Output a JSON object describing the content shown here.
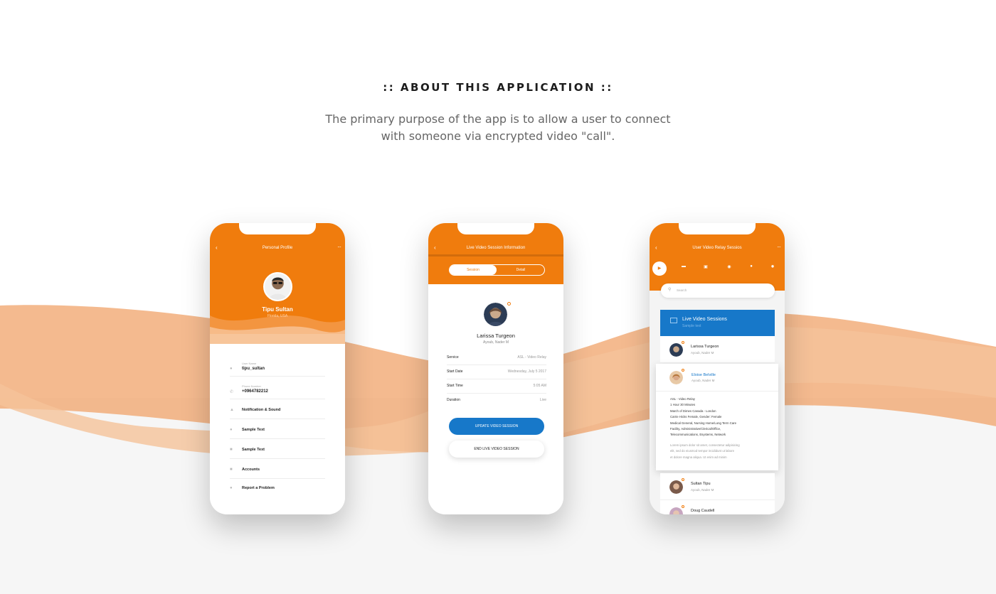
{
  "page": {
    "heading": ":: ABOUT THIS APPLICATION ::",
    "description_line1": "The primary purpose of the app is to allow a user to connect",
    "description_line2": "with someone via encrypted video \"call\".",
    "accent_color": "#f07c0d",
    "blue_color": "#1778c9"
  },
  "phone1": {
    "title": "Personal Profile",
    "back_icon": "chevron-left-icon",
    "menu_icon": "more-icon",
    "profile": {
      "name": "Tipu Sultan",
      "location": "Florida, USA"
    },
    "fields": [
      {
        "label": "User Name",
        "value": "tipu_sultan",
        "icon": "user-icon"
      },
      {
        "label": "Phone Number",
        "value": "+0964782212",
        "icon": "phone-icon"
      }
    ],
    "menu": [
      {
        "label": "Notification & Sound",
        "icon": "bell-icon"
      },
      {
        "label": "Sample Text",
        "icon": "person-icon"
      },
      {
        "label": "Sample Text",
        "icon": "card-icon"
      },
      {
        "label": "Accounts",
        "icon": "lock-icon"
      },
      {
        "label": "Report a Problem",
        "icon": "info-icon"
      }
    ]
  },
  "phone2": {
    "title": "Live Video Session Information",
    "tabs": [
      "Session",
      "Detail"
    ],
    "contact": {
      "name": "Larissa Turgeon",
      "subtitle": "Ayoub, Nader M"
    },
    "details": [
      {
        "key": "Service",
        "value": "ASL - Video Relay"
      },
      {
        "key": "Start Date",
        "value": "Wednesday, July 5 2017"
      },
      {
        "key": "Start Time",
        "value": "5:05 AM"
      },
      {
        "key": "Duration",
        "value": "Live"
      }
    ],
    "primary_button": "UPDATE VIDEO SESSION",
    "secondary_button": "END LIVE VIDEO SESSION"
  },
  "phone3": {
    "title": "User Video Relay Sessios",
    "tab_icons": [
      "play-icon",
      "screen-icon",
      "camera-icon",
      "eye-icon",
      "user-icon",
      "gear-icon"
    ],
    "search_placeholder": "Search",
    "section": {
      "title": "Live Video Sessions",
      "subtitle": "Sample text"
    },
    "items": [
      {
        "name": "Larissa Turgeon",
        "subtitle": "Ayoub, Nader M"
      },
      {
        "name": "Eloise Belville",
        "subtitle": "Ayoub, Nader M"
      },
      {
        "name": "Sultan Tipu",
        "subtitle": "Ayoub, Nader M"
      },
      {
        "name": "Doug Caudell",
        "subtitle": ""
      }
    ],
    "expanded_details": [
      "ASL - Video Relay",
      "1 Hour 30 Minutes",
      "March of Dimes Canada - London",
      "Carrie Hicks Female, Gender: Female",
      "Medical General, Nursing Home/Long Term Care",
      "Facility, Administrative/Clerical/Office,",
      "Telecommunications, Esystems, Network"
    ],
    "expanded_lorem": [
      "Lorem ipsum dolor sit amet, consectetur adipisicing",
      "elit, sed do eiusmod tempor incididunt ut labore",
      "et dolore magna aliqua. Ut enim ad minim"
    ]
  }
}
